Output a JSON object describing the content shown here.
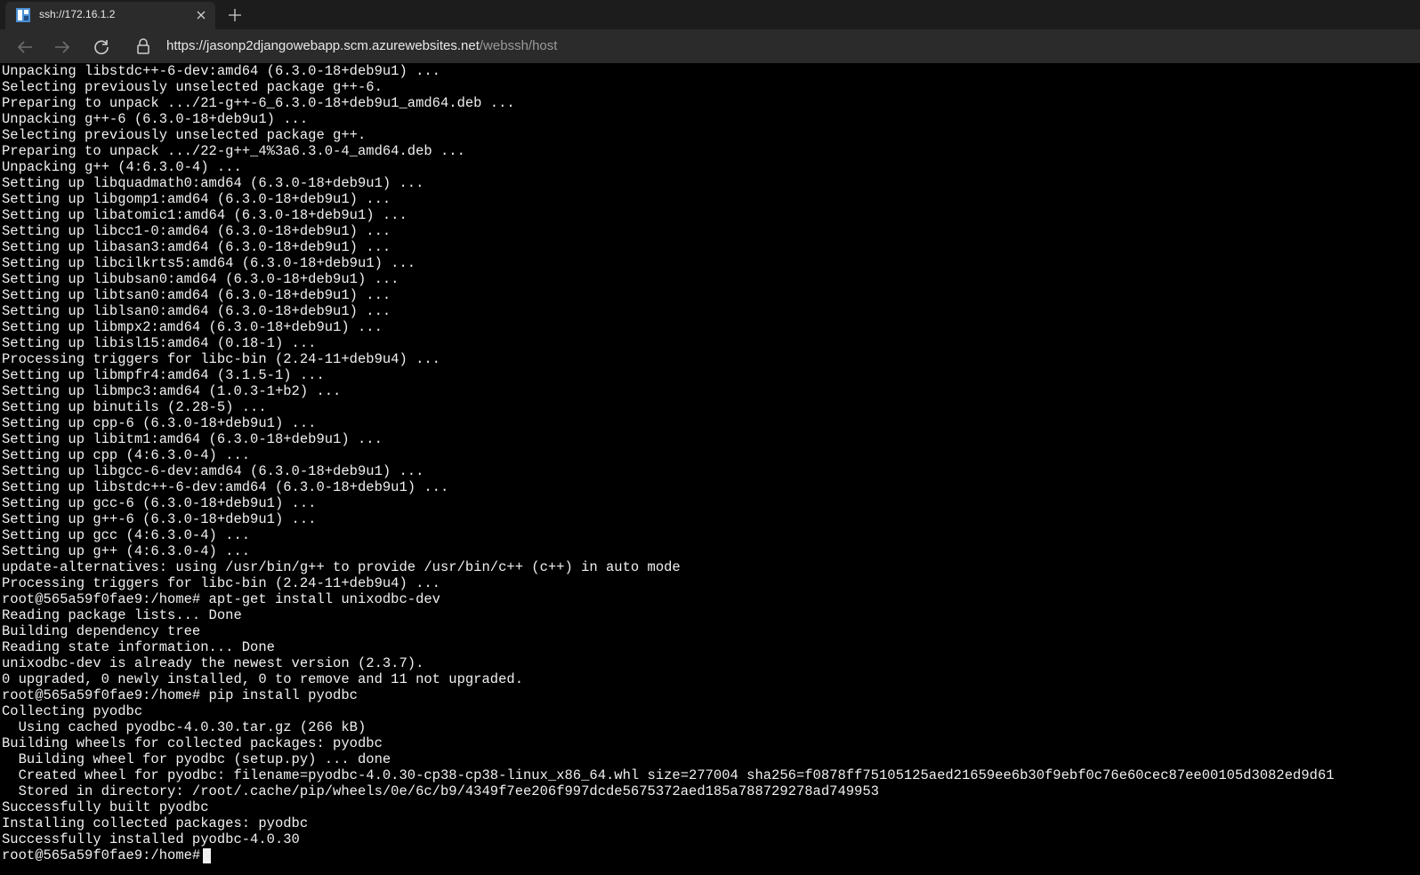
{
  "browser": {
    "tab": {
      "title": "ssh://172.16.1.2",
      "favicon": "webssh-icon"
    },
    "address_bar": {
      "url_host": "https://jasonp2djangowebapp.scm.azurewebsites.net",
      "url_path": "/webssh/host"
    },
    "colors": {
      "tabbar_bg": "#1c1c1c",
      "toolbar_bg": "#2b2b2b",
      "terminal_bg": "#000000",
      "terminal_fg": "#f0f0f0"
    }
  },
  "terminal": {
    "lines": [
      "Unpacking libstdc++-6-dev:amd64 (6.3.0-18+deb9u1) ...",
      "Selecting previously unselected package g++-6.",
      "Preparing to unpack .../21-g++-6_6.3.0-18+deb9u1_amd64.deb ...",
      "Unpacking g++-6 (6.3.0-18+deb9u1) ...",
      "Selecting previously unselected package g++.",
      "Preparing to unpack .../22-g++_4%3a6.3.0-4_amd64.deb ...",
      "Unpacking g++ (4:6.3.0-4) ...",
      "Setting up libquadmath0:amd64 (6.3.0-18+deb9u1) ...",
      "Setting up libgomp1:amd64 (6.3.0-18+deb9u1) ...",
      "Setting up libatomic1:amd64 (6.3.0-18+deb9u1) ...",
      "Setting up libcc1-0:amd64 (6.3.0-18+deb9u1) ...",
      "Setting up libasan3:amd64 (6.3.0-18+deb9u1) ...",
      "Setting up libcilkrts5:amd64 (6.3.0-18+deb9u1) ...",
      "Setting up libubsan0:amd64 (6.3.0-18+deb9u1) ...",
      "Setting up libtsan0:amd64 (6.3.0-18+deb9u1) ...",
      "Setting up liblsan0:amd64 (6.3.0-18+deb9u1) ...",
      "Setting up libmpx2:amd64 (6.3.0-18+deb9u1) ...",
      "Setting up libisl15:amd64 (0.18-1) ...",
      "Processing triggers for libc-bin (2.24-11+deb9u4) ...",
      "Setting up libmpfr4:amd64 (3.1.5-1) ...",
      "Setting up libmpc3:amd64 (1.0.3-1+b2) ...",
      "Setting up binutils (2.28-5) ...",
      "Setting up cpp-6 (6.3.0-18+deb9u1) ...",
      "Setting up libitm1:amd64 (6.3.0-18+deb9u1) ...",
      "Setting up cpp (4:6.3.0-4) ...",
      "Setting up libgcc-6-dev:amd64 (6.3.0-18+deb9u1) ...",
      "Setting up libstdc++-6-dev:amd64 (6.3.0-18+deb9u1) ...",
      "Setting up gcc-6 (6.3.0-18+deb9u1) ...",
      "Setting up g++-6 (6.3.0-18+deb9u1) ...",
      "Setting up gcc (4:6.3.0-4) ...",
      "Setting up g++ (4:6.3.0-4) ...",
      "update-alternatives: using /usr/bin/g++ to provide /usr/bin/c++ (c++) in auto mode",
      "Processing triggers for libc-bin (2.24-11+deb9u4) ...",
      "root@565a59f0fae9:/home# apt-get install unixodbc-dev",
      "Reading package lists... Done",
      "Building dependency tree",
      "Reading state information... Done",
      "unixodbc-dev is already the newest version (2.3.7).",
      "0 upgraded, 0 newly installed, 0 to remove and 11 not upgraded.",
      "root@565a59f0fae9:/home# pip install pyodbc",
      "Collecting pyodbc",
      "  Using cached pyodbc-4.0.30.tar.gz (266 kB)",
      "Building wheels for collected packages: pyodbc",
      "  Building wheel for pyodbc (setup.py) ... done",
      "  Created wheel for pyodbc: filename=pyodbc-4.0.30-cp38-cp38-linux_x86_64.whl size=277004 sha256=f0878ff75105125aed21659ee6b30f9ebf0c76e60cec87ee00105d3082ed9d61",
      "  Stored in directory: /root/.cache/pip/wheels/0e/6c/b9/4349f7ee206f997dcde5675372aed185a788729278ad749953",
      "Successfully built pyodbc",
      "Installing collected packages: pyodbc",
      "Successfully installed pyodbc-4.0.30"
    ],
    "prompt": "root@565a59f0fae9:/home# "
  }
}
